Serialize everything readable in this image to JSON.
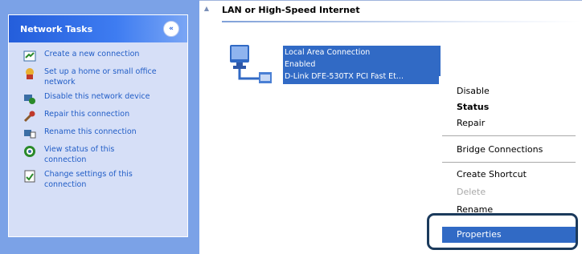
{
  "task_pane": {
    "title": "Network Tasks",
    "collapse_glyph": "«",
    "items": [
      {
        "label": "Create a new connection",
        "icon": "new-connection-icon"
      },
      {
        "label": "Set up a home or small office network",
        "icon": "home-network-icon"
      },
      {
        "label": "Disable this network device",
        "icon": "disable-device-icon"
      },
      {
        "label": "Repair this connection",
        "icon": "repair-icon"
      },
      {
        "label": "Rename this connection",
        "icon": "rename-icon"
      },
      {
        "label": "View status of this connection",
        "icon": "view-status-icon"
      },
      {
        "label": "Change settings of this connection",
        "icon": "change-settings-icon"
      }
    ]
  },
  "content": {
    "scroll_glyph": "▲",
    "group_title": "LAN or High-Speed Internet",
    "connection": {
      "name": "Local Area Connection",
      "status": "Enabled",
      "device": "D-Link DFE-530TX PCI Fast Et..."
    }
  },
  "context_menu": {
    "items": [
      {
        "label": "Disable"
      },
      {
        "label": "Status"
      },
      {
        "label": "Repair"
      },
      {
        "label": "Bridge Connections"
      },
      {
        "label": "Create Shortcut"
      },
      {
        "label": "Delete"
      },
      {
        "label": "Rename"
      },
      {
        "label": "Properties"
      }
    ]
  },
  "colors": {
    "pane_background": "#7ba2e7",
    "selection": "#316ac5",
    "link": "#215dc6",
    "callout": "#1b3a5c"
  }
}
